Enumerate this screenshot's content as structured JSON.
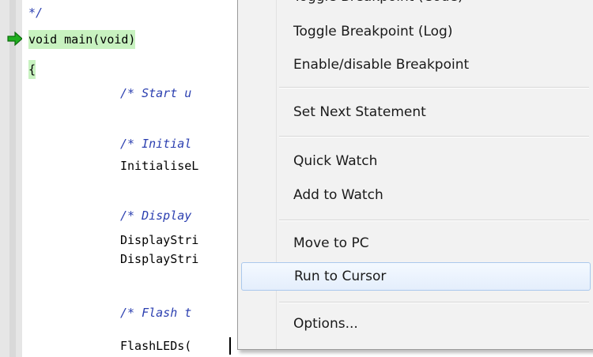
{
  "editor": {
    "lines": [
      "*/",
      "void main(void)",
      "{",
      "/* Start u",
      "/* Initial",
      "InitialiseL",
      "/* Display",
      "DisplayStri",
      "DisplayStri",
      "/* Flash t",
      "FlashLEDs("
    ],
    "current_line_icon": "green-arrow-icon"
  },
  "context_menu": {
    "items": [
      "Toggle Breakpoint (Code)",
      "Toggle Breakpoint (Log)",
      "Enable/disable Breakpoint",
      "Set Next Statement",
      "Quick Watch",
      "Add to Watch",
      "Move to PC",
      "Run to Cursor",
      "Options..."
    ],
    "selected_item": "Run to Cursor"
  },
  "colors": {
    "comment": "#2b3fb0",
    "current_line_highlight": "#c8f2c0",
    "arrow": "#1fae1f",
    "menu_background": "#f2f2f2",
    "selection_border": "#aac8ec"
  }
}
